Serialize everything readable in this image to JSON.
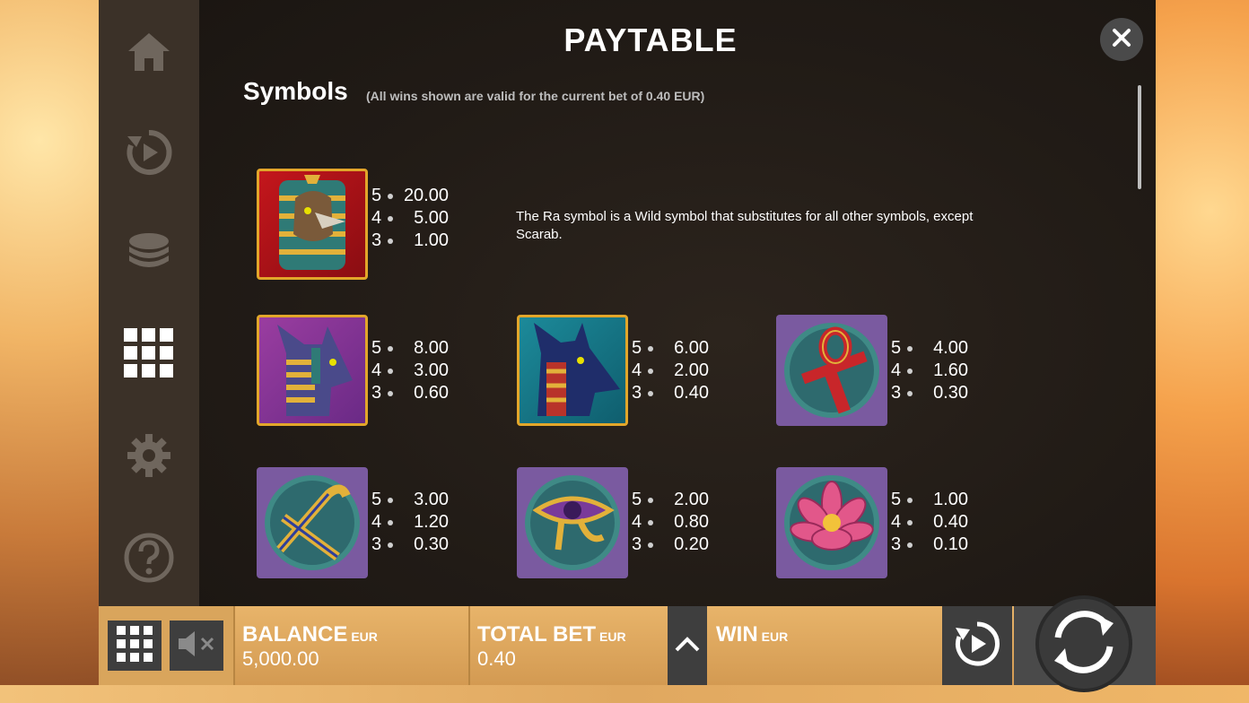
{
  "header": {
    "title": "PAYTABLE"
  },
  "section": {
    "title": "Symbols",
    "note": "(All wins shown are valid for the current bet of 0.40 EUR)"
  },
  "wild_description": "The Ra symbol is a Wild symbol that substitutes for all other symbols, except Scarab.",
  "symbols": [
    {
      "name": "Ra",
      "pays": [
        {
          "n": "5",
          "v": "20.00"
        },
        {
          "n": "4",
          "v": "5.00"
        },
        {
          "n": "3",
          "v": "1.00"
        }
      ]
    },
    {
      "name": "Bastet",
      "pays": [
        {
          "n": "5",
          "v": "8.00"
        },
        {
          "n": "4",
          "v": "3.00"
        },
        {
          "n": "3",
          "v": "0.60"
        }
      ]
    },
    {
      "name": "Anubis",
      "pays": [
        {
          "n": "5",
          "v": "6.00"
        },
        {
          "n": "4",
          "v": "2.00"
        },
        {
          "n": "3",
          "v": "0.40"
        }
      ]
    },
    {
      "name": "Ankh",
      "pays": [
        {
          "n": "5",
          "v": "4.00"
        },
        {
          "n": "4",
          "v": "1.60"
        },
        {
          "n": "3",
          "v": "0.30"
        }
      ]
    },
    {
      "name": "Crook and Flail",
      "pays": [
        {
          "n": "5",
          "v": "3.00"
        },
        {
          "n": "4",
          "v": "1.20"
        },
        {
          "n": "3",
          "v": "0.30"
        }
      ]
    },
    {
      "name": "Eye of Horus",
      "pays": [
        {
          "n": "5",
          "v": "2.00"
        },
        {
          "n": "4",
          "v": "0.80"
        },
        {
          "n": "3",
          "v": "0.20"
        }
      ]
    },
    {
      "name": "Lotus",
      "pays": [
        {
          "n": "5",
          "v": "1.00"
        },
        {
          "n": "4",
          "v": "0.40"
        },
        {
          "n": "3",
          "v": "0.10"
        }
      ]
    }
  ],
  "footer": {
    "balance_label": "BALANCE",
    "balance_currency": "EUR",
    "balance_value": "5,000.00",
    "bet_label": "TOTAL BET",
    "bet_currency": "EUR",
    "bet_value": "0.40",
    "win_label": "WIN",
    "win_currency": "EUR"
  },
  "icons": {
    "sidebar": [
      "home-icon",
      "replay-icon",
      "coins-icon",
      "paytable-grid-icon",
      "settings-gear-icon",
      "help-icon"
    ],
    "close": "close-icon",
    "menu": "menu-grid-icon",
    "sound": "sound-muted-icon",
    "bet_up": "chevron-up-icon",
    "autoplay": "autoplay-icon",
    "spin": "spin-icon"
  },
  "colors": {
    "panel": "#211b16",
    "sidebar": "#3b3128",
    "bottom_bar": "#e0aa60",
    "button": "#3e3e3e"
  }
}
